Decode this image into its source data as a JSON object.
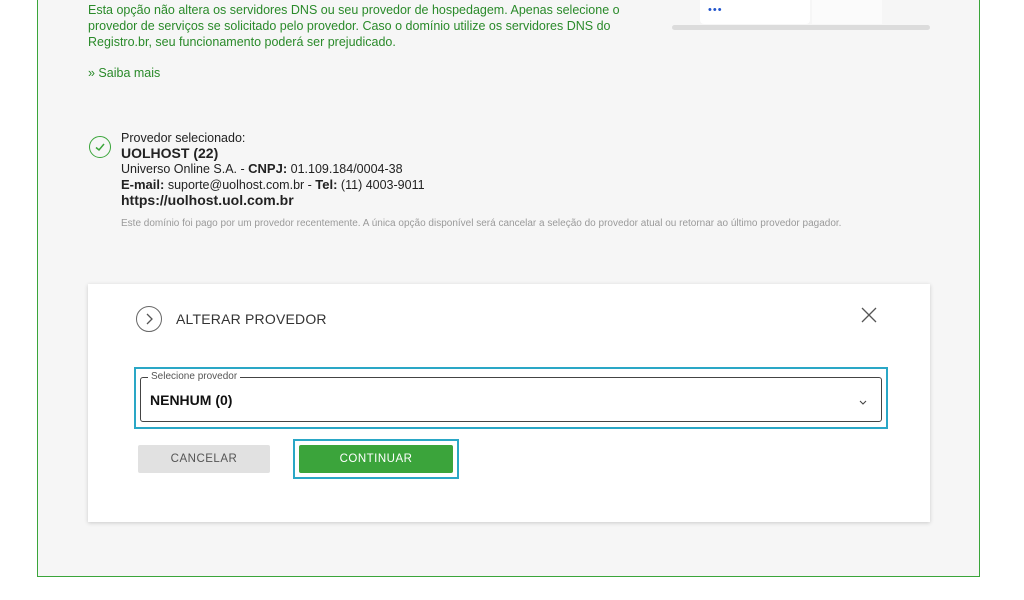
{
  "intro": {
    "text": "Esta opção não altera os servidores DNS ou seu provedor de hospedagem. Apenas selecione o provedor de serviços se solicitado pelo provedor. Caso o domínio utilize os servidores DNS do Registro.br, seu funcionamento poderá ser prejudicado.",
    "link": "» Saiba mais",
    "illustration_dots": "•••"
  },
  "provider": {
    "label": "Provedor selecionado:",
    "name": "UOLHOST (22)",
    "company": "Universo Online S.A. - ",
    "cnpj_label": "CNPJ:",
    "cnpj": " 01.109.184/0004-38",
    "email_label": "E-mail:",
    "email": " suporte@uolhost.com.br - ",
    "tel_label": "Tel:",
    "tel": " (11) 4003-9011",
    "url": "https://uolhost.uol.com.br",
    "note": "Este domínio foi pago por um provedor recentemente. A única opção disponível será cancelar a seleção do provedor atual ou retornar ao último provedor pagador."
  },
  "modal": {
    "title": "ALTERAR PROVEDOR",
    "select_label": "Selecione provedor",
    "select_value": "NENHUM (0)",
    "cancel_label": "CANCELAR",
    "continue_label": "CONTINUAR"
  },
  "colors": {
    "brand_green": "#3ba43b",
    "highlight": "#2aa7c6"
  }
}
